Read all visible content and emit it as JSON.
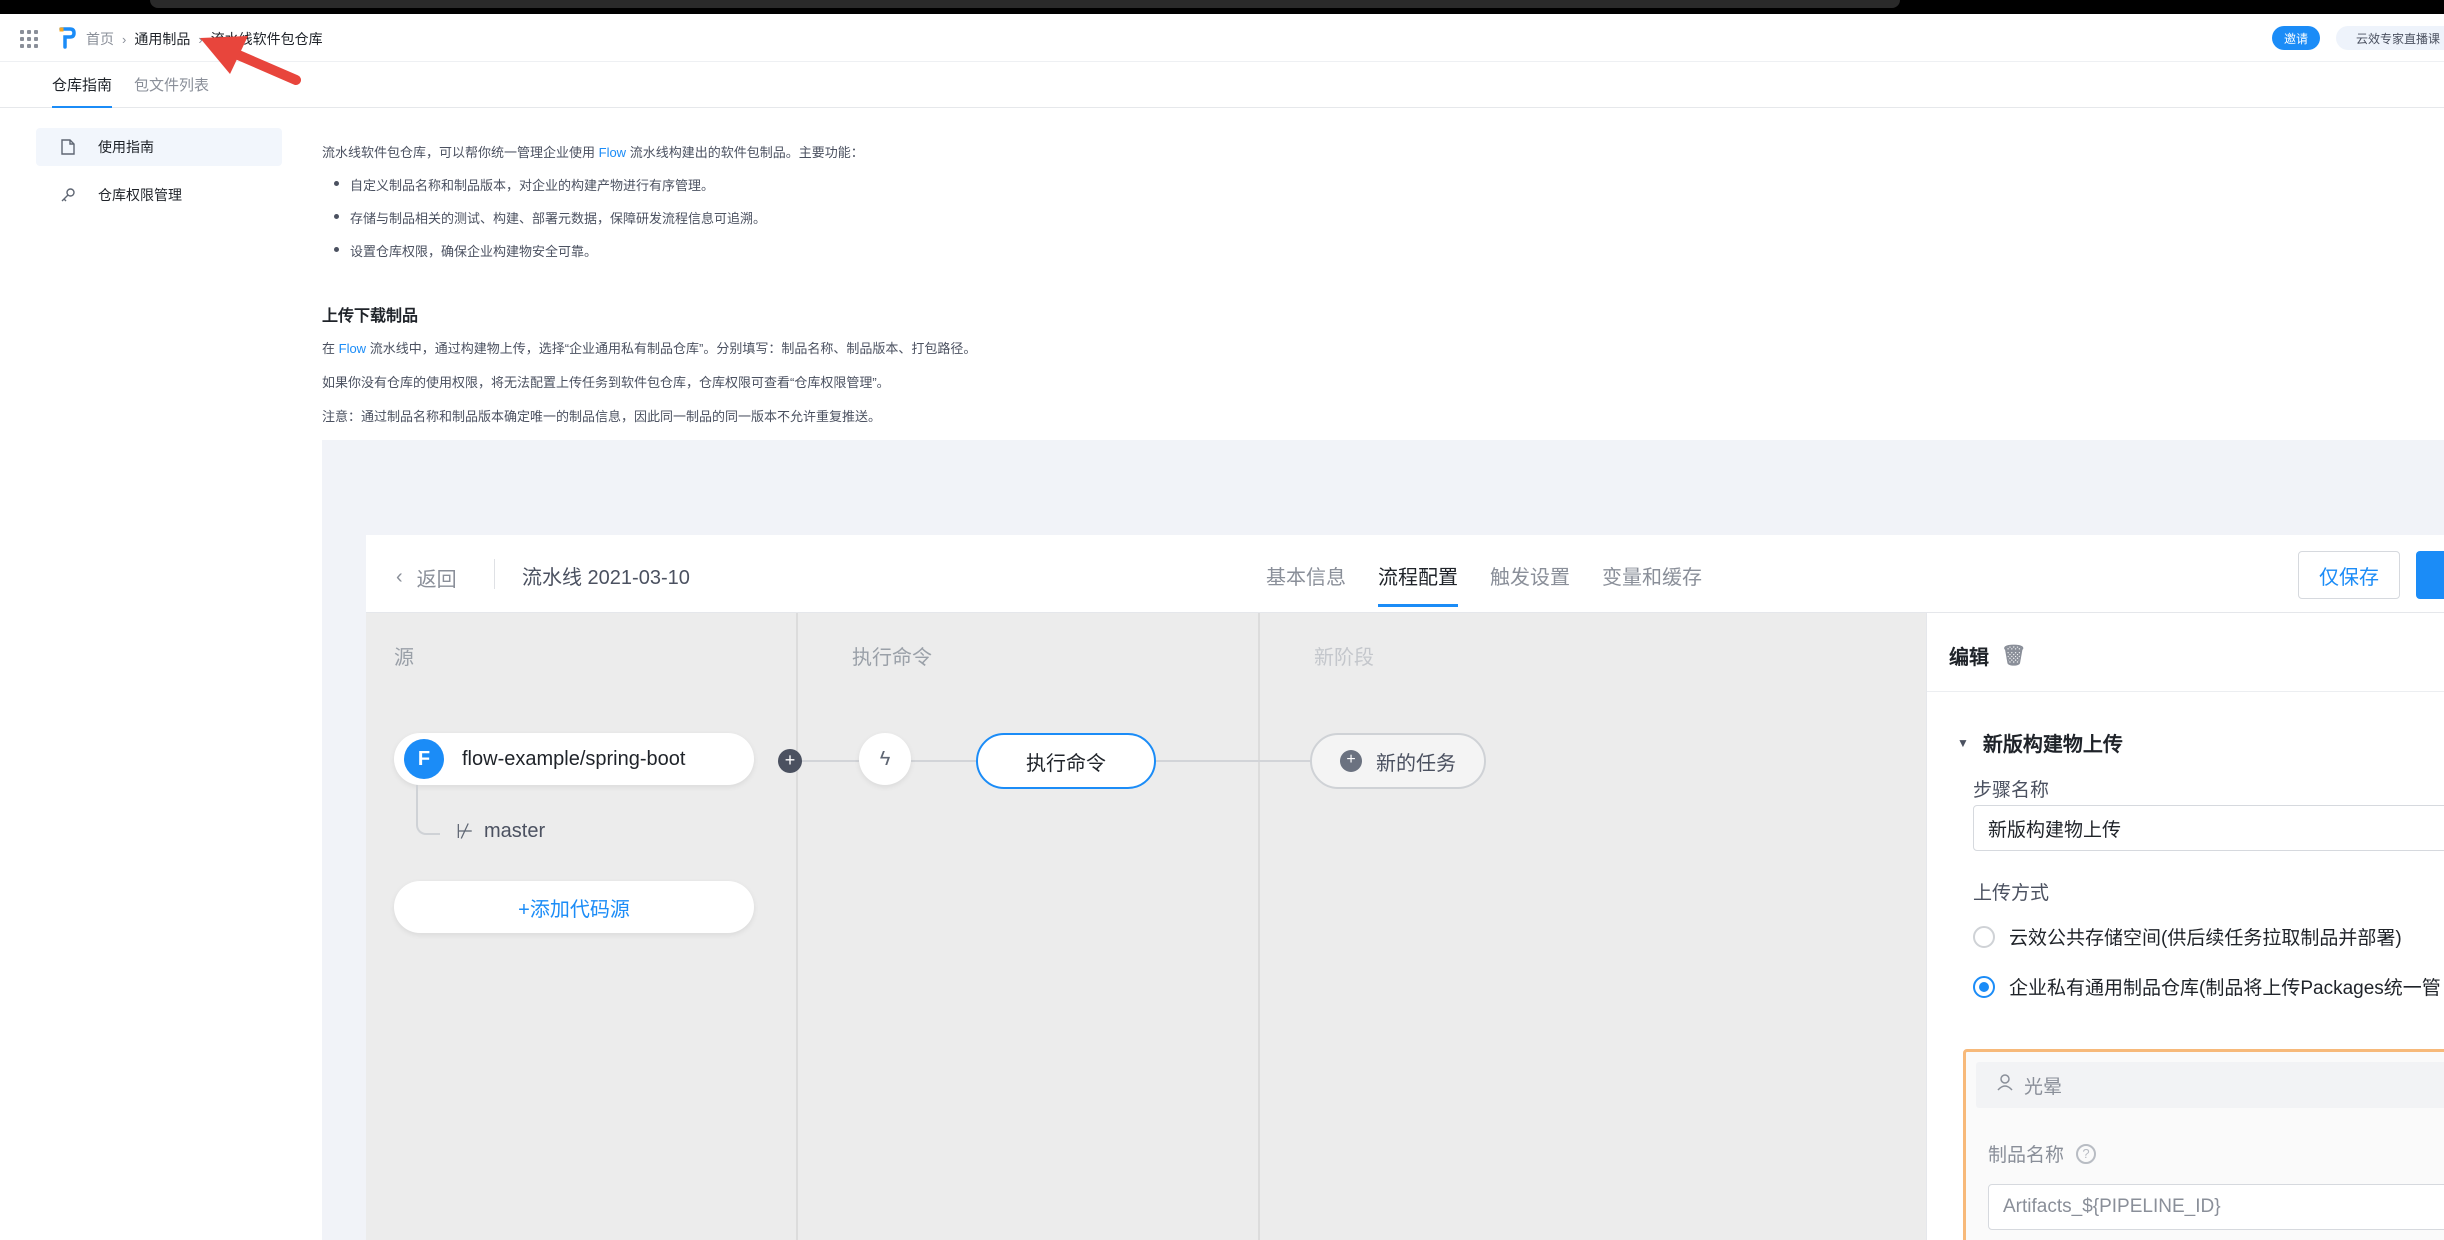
{
  "header": {
    "breadcrumb": [
      "首页",
      "通用制品",
      "流水线软件包仓库"
    ],
    "invite_label": "邀请",
    "live_label": "云效专家直播课"
  },
  "tabs": [
    "仓库指南",
    "包文件列表"
  ],
  "sidebar": {
    "items": [
      {
        "label": "使用指南",
        "icon": "document-icon",
        "active": true
      },
      {
        "label": "仓库权限管理",
        "icon": "key-icon",
        "active": false
      }
    ]
  },
  "guide": {
    "intro_pre": "流水线软件包仓库，可以帮你统一管理企业使用 ",
    "intro_link": "Flow",
    "intro_post": " 流水线构建出的软件包制品。主要功能：",
    "bullets": [
      "自定义制品名称和制品版本，对企业的构建产物进行有序管理。",
      "存储与制品相关的测试、构建、部署元数据，保障研发流程信息可追溯。",
      "设置仓库权限，确保企业构建物安全可靠。"
    ],
    "section_title": "上传下载制品",
    "p1_pre": "在 ",
    "p1_link": "Flow",
    "p1_post": " 流水线中，通过构建物上传，选择“企业通用私有制品仓库”。分别填写：制品名称、制品版本、打包路径。",
    "p2": "如果你没有仓库的使用权限，将无法配置上传任务到软件包仓库，仓库权限可查看“仓库权限管理”。",
    "p3": "注意：通过制品名称和制品版本确定唯一的制品信息，因此同一制品的同一版本不允许重复推送。"
  },
  "screenshot": {
    "back_label": "返回",
    "pipeline_title": "流水线 2021-03-10",
    "tabs": [
      "基本信息",
      "流程配置",
      "触发设置",
      "变量和缓存"
    ],
    "active_tab": "流程配置",
    "save_label": "仅保存",
    "columns": [
      "源",
      "执行命令",
      "新阶段"
    ],
    "source_repo": "flow-example/spring-boot",
    "source_logo": "F",
    "branch": "master",
    "add_source": "+添加代码源",
    "command_node": "执行命令",
    "new_task": "新的任务",
    "panel": {
      "title": "编辑",
      "section": "新版构建物上传",
      "step_name_label": "步骤名称",
      "step_name_value": "新版构建物上传",
      "upload_method_label": "上传方式",
      "option_public": "云效公共存储空间(供后续任务拉取制品并部署)",
      "option_private": "企业私有通用制品仓库(制品将上传Packages统一管",
      "owner": "光晕",
      "artifact_name_label": "制品名称",
      "artifact_name_value": "Artifacts_${PIPELINE_ID}"
    }
  },
  "colors": {
    "accent": "#1b8cf7",
    "annotation_arrow": "#e8453c",
    "highlight_border": "#f7b97a"
  }
}
